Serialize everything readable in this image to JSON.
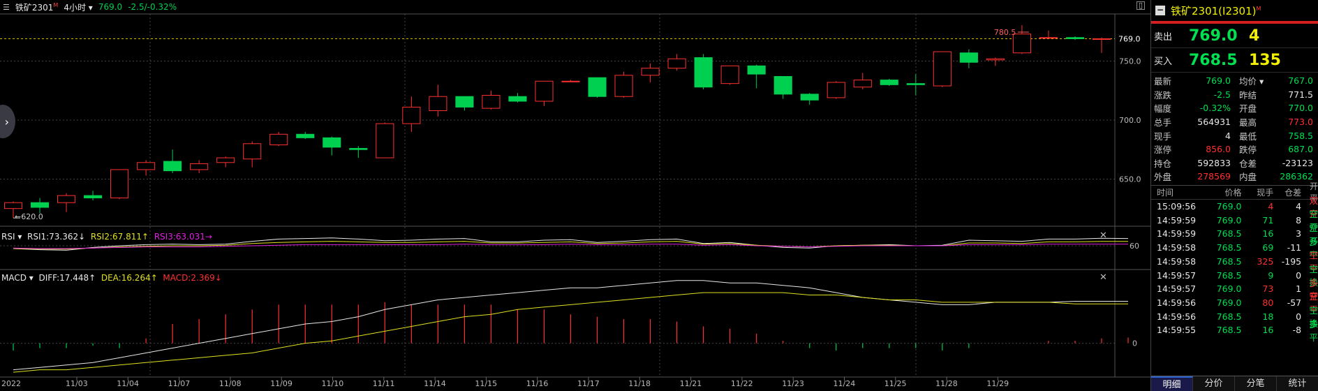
{
  "topbar": {
    "menu_icon": "menu-lines-icon",
    "symbol": "铁矿2301",
    "symbol_mark": "M",
    "period": "4小时",
    "last_price": "769.0",
    "change": "-2.5/-0.32%"
  },
  "chart_data": [
    {
      "type": "candlestick",
      "name": "main",
      "x": [
        "",
        "11/03",
        "11/04",
        "11/07",
        "11/08",
        "11/09",
        "11/10",
        "11/11",
        "11/14",
        "11/15",
        "11/16",
        "11/17",
        "11/18",
        "11/21",
        "11/22",
        "11/23",
        "11/24",
        "11/25",
        "11/28",
        "11/29"
      ],
      "x_start_label": "2022",
      "ylim": [
        610,
        790
      ],
      "y_ticks": [
        "769.0",
        "750.0",
        "700.0",
        "650.0"
      ],
      "last_price_line": 769.0,
      "high_annotation": "780.5",
      "low_annotation": "620.0",
      "candles": [
        {
          "o": 625,
          "h": 631,
          "l": 617,
          "c": 630
        },
        {
          "o": 630,
          "h": 634,
          "l": 621,
          "c": 626
        },
        {
          "o": 630,
          "h": 638,
          "l": 622,
          "c": 636
        },
        {
          "o": 636,
          "h": 640,
          "l": 632,
          "c": 634
        },
        {
          "o": 634,
          "h": 658,
          "l": 633,
          "c": 658
        },
        {
          "o": 658,
          "h": 666,
          "l": 653,
          "c": 664
        },
        {
          "o": 665,
          "h": 675,
          "l": 655,
          "c": 657
        },
        {
          "o": 658,
          "h": 666,
          "l": 655,
          "c": 663
        },
        {
          "o": 664,
          "h": 669,
          "l": 660,
          "c": 668
        },
        {
          "o": 667,
          "h": 682,
          "l": 660,
          "c": 680
        },
        {
          "o": 679,
          "h": 690,
          "l": 678,
          "c": 688
        },
        {
          "o": 688,
          "h": 690,
          "l": 684,
          "c": 685
        },
        {
          "o": 685,
          "h": 686,
          "l": 670,
          "c": 677
        },
        {
          "o": 676,
          "h": 678,
          "l": 668,
          "c": 675
        },
        {
          "o": 668,
          "h": 698,
          "l": 668,
          "c": 697
        },
        {
          "o": 697,
          "h": 720,
          "l": 690,
          "c": 711
        },
        {
          "o": 708,
          "h": 730,
          "l": 703,
          "c": 720
        },
        {
          "o": 720,
          "h": 720,
          "l": 708,
          "c": 711
        },
        {
          "o": 710,
          "h": 725,
          "l": 709,
          "c": 721
        },
        {
          "o": 720,
          "h": 723,
          "l": 715,
          "c": 716
        },
        {
          "o": 716,
          "h": 732,
          "l": 712,
          "c": 733
        },
        {
          "o": 733,
          "h": 734,
          "l": 733,
          "c": 733
        },
        {
          "o": 736,
          "h": 736,
          "l": 719,
          "c": 720
        },
        {
          "o": 720,
          "h": 741,
          "l": 719,
          "c": 738
        },
        {
          "o": 738,
          "h": 748,
          "l": 732,
          "c": 744
        },
        {
          "o": 744,
          "h": 756,
          "l": 742,
          "c": 752
        },
        {
          "o": 753,
          "h": 756,
          "l": 726,
          "c": 728
        },
        {
          "o": 731,
          "h": 745,
          "l": 730,
          "c": 746
        },
        {
          "o": 746,
          "h": 747,
          "l": 727,
          "c": 739
        },
        {
          "o": 737,
          "h": 737,
          "l": 718,
          "c": 722
        },
        {
          "o": 722,
          "h": 723,
          "l": 713,
          "c": 717
        },
        {
          "o": 719,
          "h": 733,
          "l": 718,
          "c": 732
        },
        {
          "o": 728,
          "h": 740,
          "l": 726,
          "c": 734
        },
        {
          "o": 734,
          "h": 735,
          "l": 729,
          "c": 730
        },
        {
          "o": 731,
          "h": 739,
          "l": 721,
          "c": 730
        },
        {
          "o": 729,
          "h": 756,
          "l": 728,
          "c": 758
        },
        {
          "o": 757,
          "h": 760,
          "l": 744,
          "c": 749
        },
        {
          "o": 751,
          "h": 753,
          "l": 746,
          "c": 752
        },
        {
          "o": 757,
          "h": 780.5,
          "l": 756,
          "c": 773
        },
        {
          "o": 770,
          "h": 776,
          "l": 769,
          "c": 770
        },
        {
          "o": 770,
          "h": 771,
          "l": 768,
          "c": 769
        },
        {
          "o": 769,
          "h": 770,
          "l": 757,
          "c": 769
        }
      ]
    },
    {
      "type": "line",
      "name": "RSI",
      "label": "RSI",
      "ylim": [
        20,
        90
      ],
      "y_ticks": [
        "60"
      ],
      "series": [
        {
          "name": "RSI1:73.362↓",
          "color": "#e8e8e8",
          "values": [
            55,
            53,
            52,
            57,
            60,
            62,
            63,
            62,
            63,
            68,
            72,
            73,
            74,
            72,
            69,
            70,
            72,
            73,
            67,
            67,
            70,
            71,
            66,
            68,
            71,
            72,
            64,
            66,
            61,
            57,
            56,
            60,
            61,
            62,
            60,
            61,
            70,
            69,
            68,
            72,
            72,
            73.4,
            73
          ]
        },
        {
          "name": "RSI2:67.811↑",
          "color": "#e0e020",
          "values": [
            55,
            54,
            54,
            56,
            58,
            59,
            60,
            60,
            61,
            64,
            66,
            67,
            68,
            67,
            66,
            66,
            67,
            68,
            65,
            65,
            66,
            67,
            64,
            65,
            67,
            68,
            63,
            64,
            61,
            59,
            58,
            60,
            61,
            61,
            60,
            60,
            65,
            65,
            64,
            67,
            67,
            67.8,
            67.8
          ]
        },
        {
          "name": "RSI3:63.031→",
          "color": "#e020e0",
          "values": [
            56,
            55,
            55,
            56,
            57,
            58,
            58,
            58,
            59,
            60,
            61,
            62,
            62,
            62,
            62,
            62,
            62,
            63,
            62,
            62,
            62,
            63,
            62,
            62,
            63,
            63,
            61,
            62,
            60,
            59,
            58,
            59,
            60,
            60,
            60,
            60,
            62,
            62,
            62,
            63,
            63,
            63,
            63
          ]
        }
      ]
    },
    {
      "type": "bar+line",
      "name": "MACD",
      "label": "MACD",
      "ylim": [
        -14,
        30
      ],
      "y_ticks": [
        "0"
      ],
      "series": [
        {
          "name": "DIFF:17.448↑",
          "color": "#e8e8e8",
          "values": [
            -11,
            -10,
            -9,
            -8,
            -6,
            -4,
            -2,
            0,
            2,
            4,
            6,
            8,
            9,
            11,
            14,
            16,
            18,
            19,
            20,
            21,
            22,
            23,
            23,
            24,
            25,
            26,
            26,
            25,
            25,
            24,
            23,
            21,
            19,
            18,
            17,
            16,
            16,
            17,
            17,
            17,
            17.4,
            17.4,
            17.4
          ]
        },
        {
          "name": "DEA:16.264↑",
          "color": "#e0e020",
          "values": [
            -12,
            -11,
            -11,
            -10,
            -9,
            -8,
            -7,
            -6,
            -5,
            -4,
            -2,
            0,
            1,
            3,
            5,
            7,
            9,
            11,
            12,
            14,
            15,
            16,
            17,
            18,
            19,
            20,
            21,
            21,
            21,
            21,
            20,
            20,
            19,
            18,
            18,
            17,
            17,
            17,
            17,
            17,
            16.3,
            16.3,
            16.3
          ]
        },
        {
          "name": "MACD:2.369↓",
          "color": "#ff3030",
          "bars": [
            -3,
            -2,
            -2,
            -1,
            -2,
            2,
            8,
            10,
            12,
            14,
            16,
            16,
            16,
            16,
            17,
            16,
            16,
            16,
            16,
            14,
            14,
            12,
            11,
            10,
            10,
            9,
            7,
            6,
            4,
            1,
            -2,
            -3,
            -2,
            -2,
            -2,
            -3,
            -2,
            0,
            0,
            1,
            1,
            2,
            2.4
          ]
        }
      ]
    }
  ],
  "right_panel": {
    "title": "铁矿2301(I2301)",
    "title_mark": "M",
    "sell": {
      "label": "卖出",
      "price": "769.0",
      "qty": "4"
    },
    "buy": {
      "label": "买入",
      "price": "768.5",
      "qty": "135"
    },
    "quote": [
      {
        "l": "最新",
        "v": "769.0",
        "vc": "green",
        "l2": "均价",
        "v2": "767.0",
        "v2c": "green"
      },
      {
        "l": "涨跌",
        "v": "-2.5",
        "vc": "green",
        "l2": "昨结",
        "v2": "771.5",
        "v2c": "white"
      },
      {
        "l": "幅度",
        "v": "-0.32%",
        "vc": "green",
        "l2": "开盘",
        "v2": "770.0",
        "v2c": "green"
      },
      {
        "l": "总手",
        "v": "564931",
        "vc": "white",
        "l2": "最高",
        "v2": "773.0",
        "v2c": "red"
      },
      {
        "l": "现手",
        "v": "4",
        "vc": "white",
        "l2": "最低",
        "v2": "758.5",
        "v2c": "green"
      },
      {
        "l": "涨停",
        "v": "856.0",
        "vc": "red",
        "l2": "跌停",
        "v2": "687.0",
        "v2c": "green"
      },
      {
        "l": "持仓",
        "v": "592833",
        "vc": "white",
        "l2": "仓差",
        "v2": "-23123",
        "v2c": "white"
      },
      {
        "l": "外盘",
        "v": "278569",
        "vc": "red",
        "l2": "内盘",
        "v2": "286362",
        "v2c": "green"
      }
    ],
    "avg_dropdown_icon": "caret-down-icon",
    "ticks_header": {
      "time": "时间",
      "price": "价格",
      "vol": "现手",
      "oi": "仓差",
      "type": "开平"
    },
    "ticks": [
      {
        "time": "15:09:56",
        "price": "769.0",
        "pc": "green",
        "vol": "4",
        "vc": "red",
        "oi": "4",
        "type": "双开",
        "tc": "red"
      },
      {
        "time": "14:59:59",
        "price": "769.0",
        "pc": "green",
        "vol": "71",
        "vc": "green",
        "oi": "8",
        "type": "空开",
        "tc": "green"
      },
      {
        "time": "14:59:59",
        "price": "768.5",
        "pc": "green",
        "vol": "16",
        "vc": "green",
        "oi": "3",
        "type": "空开",
        "tc": "green"
      },
      {
        "time": "14:59:58",
        "price": "768.5",
        "pc": "green",
        "vol": "69",
        "vc": "green",
        "oi": "-11",
        "type": "多平",
        "tc": "green"
      },
      {
        "time": "14:59:58",
        "price": "768.5",
        "pc": "green",
        "vol": "325",
        "vc": "red",
        "oi": "-195",
        "type": "空平",
        "tc": "red"
      },
      {
        "time": "14:59:57",
        "price": "768.5",
        "pc": "green",
        "vol": "9",
        "vc": "green",
        "oi": "0",
        "type": "空换",
        "tc": "green"
      },
      {
        "time": "14:59:57",
        "price": "769.0",
        "pc": "green",
        "vol": "73",
        "vc": "red",
        "oi": "1",
        "type": "多开",
        "tc": "red"
      },
      {
        "time": "14:59:56",
        "price": "769.0",
        "pc": "green",
        "vol": "80",
        "vc": "red",
        "oi": "-57",
        "type": "空平",
        "tc": "red"
      },
      {
        "time": "14:59:56",
        "price": "768.5",
        "pc": "green",
        "vol": "18",
        "vc": "green",
        "oi": "0",
        "type": "空换",
        "tc": "green"
      },
      {
        "time": "14:59:55",
        "price": "768.5",
        "pc": "green",
        "vol": "16",
        "vc": "green",
        "oi": "-8",
        "type": "多平",
        "tc": "green"
      }
    ],
    "tabs": [
      "明细",
      "分价",
      "分笔",
      "统计"
    ]
  },
  "colors": {
    "up": "#ff3030",
    "down": "#00d050",
    "grid": "#444444",
    "price_line": "#d8c000"
  }
}
